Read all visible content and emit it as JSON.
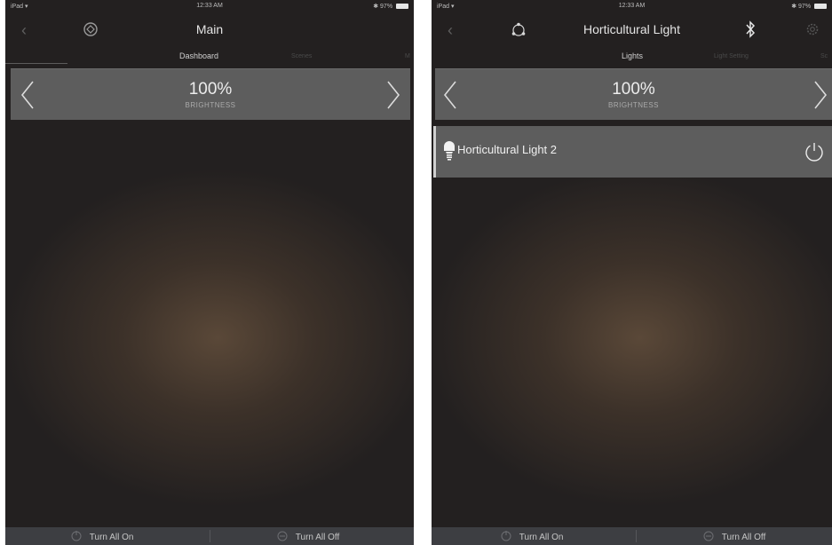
{
  "left_panel": {
    "status": {
      "device": "iPad",
      "time": "12:33 AM",
      "battery": "97%"
    },
    "nav": {
      "title": "Main"
    },
    "tabs": [
      {
        "label": "Dashboard"
      },
      {
        "label": "Scenes"
      },
      {
        "label": "M"
      }
    ],
    "brightness": {
      "value": "100%",
      "label": "BRIGHTNESS"
    },
    "bottom": {
      "on_label": "Turn All On",
      "off_label": "Turn All Off"
    }
  },
  "right_panel": {
    "status": {
      "device": "iPad",
      "time": "12:33 AM",
      "battery": "97%"
    },
    "nav": {
      "title": "Horticultural Light"
    },
    "tabs": [
      {
        "label": "Lights"
      },
      {
        "label": "Light Setting"
      },
      {
        "label": "Sc"
      }
    ],
    "brightness": {
      "value": "100%",
      "label": "BRIGHTNESS"
    },
    "lights": [
      {
        "name": "Horticultural Light 2"
      }
    ],
    "bottom": {
      "on_label": "Turn All On",
      "off_label": "Turn All Off"
    }
  }
}
